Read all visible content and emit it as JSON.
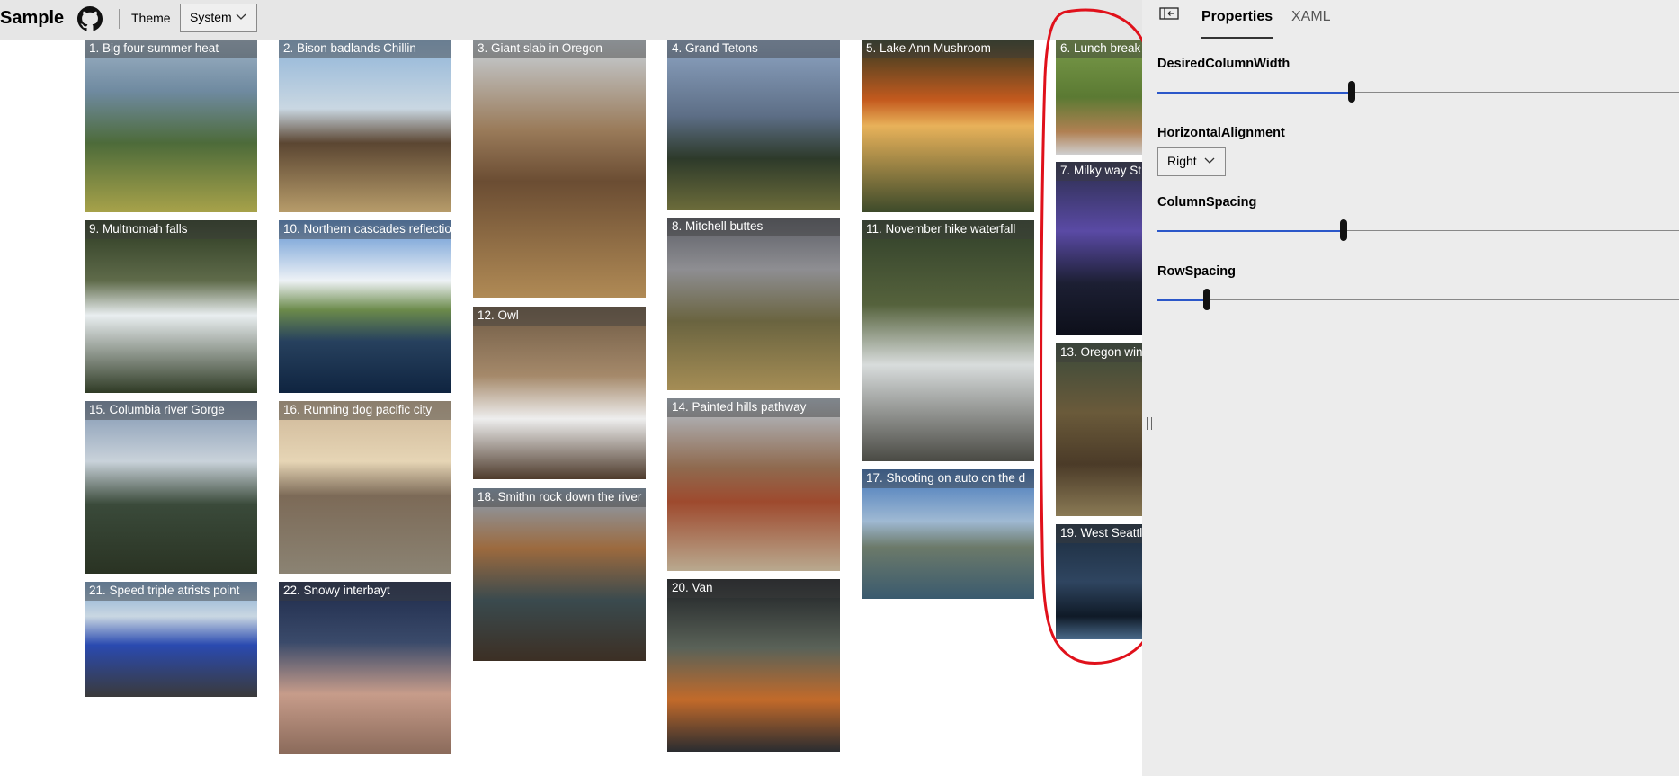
{
  "header": {
    "title": "Sample",
    "theme_label": "Theme",
    "theme_value": "System"
  },
  "gallery": {
    "items": [
      "1. Big four summer heat",
      "2. Bison badlands Chillin",
      "3. Giant slab in Oregon",
      "4. Grand Tetons",
      "5. Lake Ann Mushroom",
      "6. Lunch break",
      "7. Milky way St",
      "8. Mitchell buttes",
      "9. Multnomah falls",
      "10. Northern cascades reflectio",
      "11. November hike waterfall",
      "12. Owl",
      "13. Oregon win",
      "14. Painted hills pathway",
      "15. Columbia river Gorge",
      "16. Running dog pacific city",
      "17. Shooting on auto on the d",
      "18. Smithn rock down the river",
      "19. West Seattl",
      "20. Van",
      "21. Speed triple atrists point",
      "22. Snowy interbayt"
    ]
  },
  "panel": {
    "tabs": [
      "Properties",
      "XAML"
    ],
    "active_tab": "Properties",
    "properties": {
      "desired_column_width": {
        "label": "DesiredColumnWidth",
        "value": 0.372
      },
      "horizontal_alignment": {
        "label": "HorizontalAlignment",
        "value": "Right"
      },
      "column_spacing": {
        "label": "ColumnSpacing",
        "value": 0.357
      },
      "row_spacing": {
        "label": "RowSpacing",
        "value": 0.094
      }
    }
  },
  "colors": {
    "slider_fill": "#2b57c9",
    "annotation": "#e0111b",
    "panel_bg": "#ececec",
    "header_bg": "#e6e6e6"
  },
  "icons": [
    "github-icon",
    "chevron-down-icon",
    "pane-toggle-icon"
  ]
}
